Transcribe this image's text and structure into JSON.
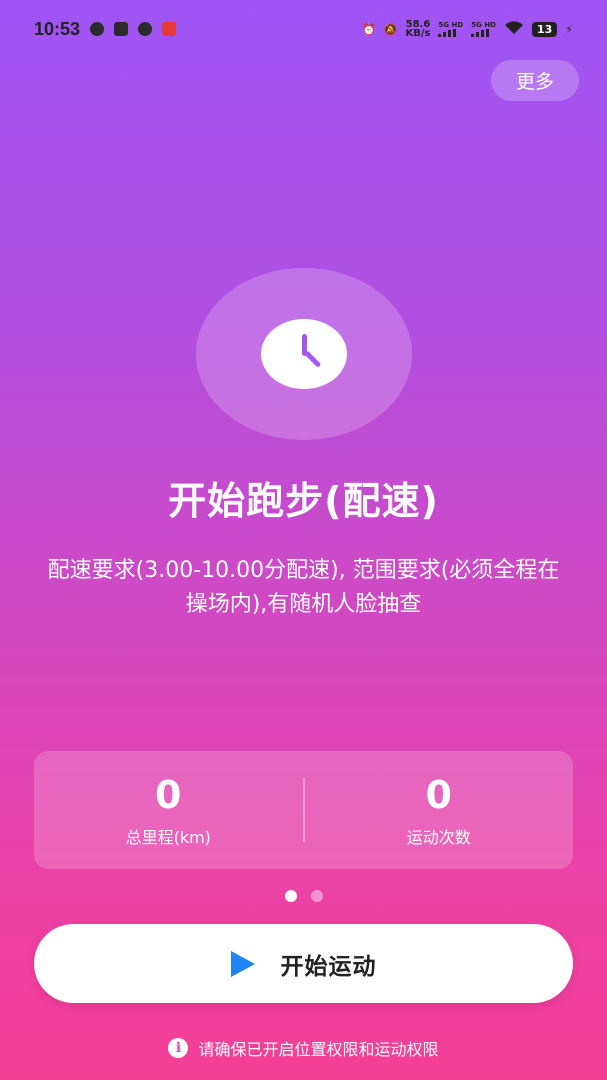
{
  "status_bar": {
    "time": "10:53",
    "net_speed_value": "58.6",
    "net_speed_unit": "KB/s",
    "sim1": "5G HD",
    "sim2": "5G HD",
    "battery": "13"
  },
  "header": {
    "more_label": "更多"
  },
  "hero": {
    "icon": "clock-icon",
    "title": "开始跑步(配速)",
    "description": "配速要求(3.00-10.00分配速), 范围要求(必须全程在操场内),有随机人脸抽查"
  },
  "stats": [
    {
      "value": "0",
      "label": "总里程(km)"
    },
    {
      "value": "0",
      "label": "运动次数"
    }
  ],
  "pager": {
    "count": 2,
    "active_index": 0
  },
  "start_button": {
    "label": "开始运动",
    "icon": "play-icon",
    "icon_color": "#1f84f5"
  },
  "notice": {
    "icon": "info-icon",
    "text": "请确保已开启位置权限和运动权限"
  },
  "colors": {
    "gradient_top": "#9f55f4",
    "gradient_bottom": "#f43f95",
    "accent": "#1f84f5"
  }
}
